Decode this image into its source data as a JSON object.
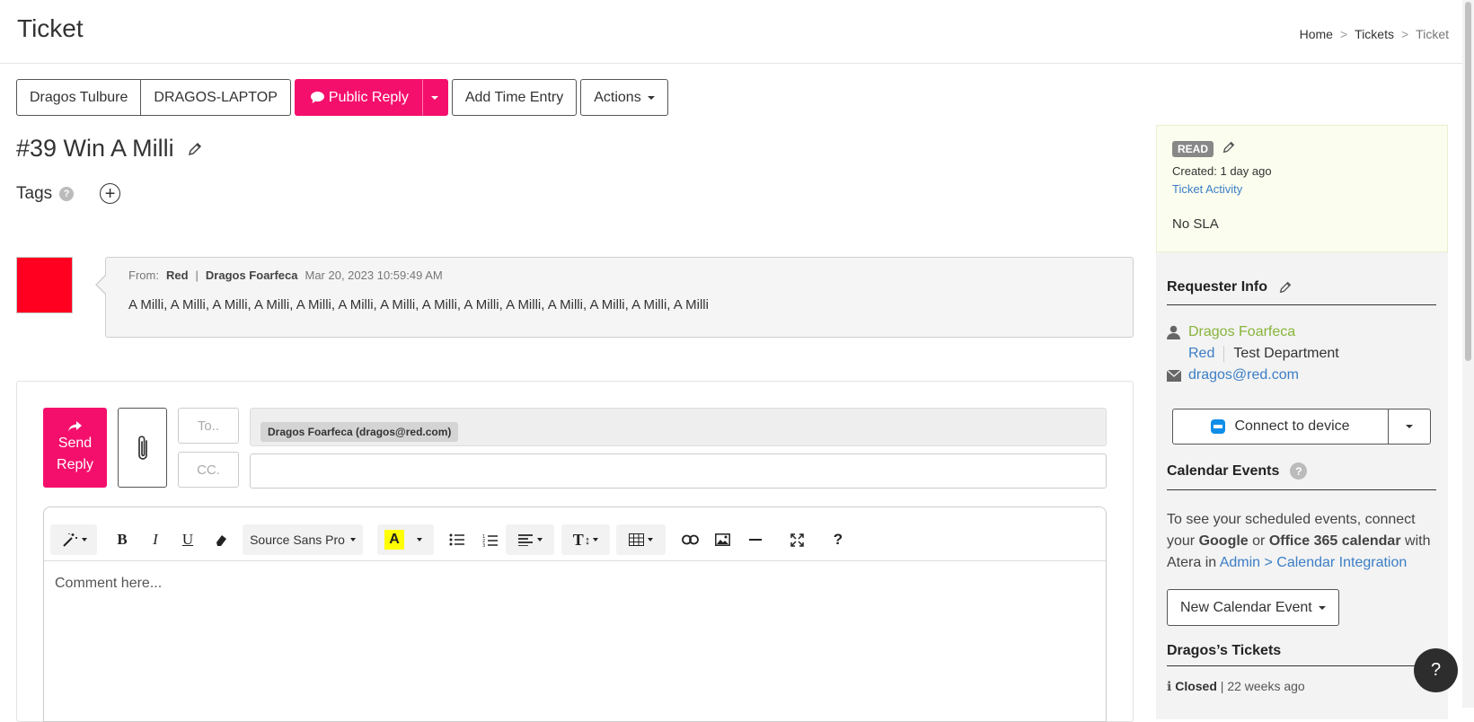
{
  "header": {
    "title": "Ticket",
    "breadcrumb": [
      "Home",
      "Tickets",
      "Ticket"
    ],
    "breadcrumb_sep": ">"
  },
  "toolbar": {
    "customer": "Dragos Tulbure",
    "device": "DRAGOS-LAPTOP",
    "public_reply": "Public Reply",
    "add_time_entry": "Add Time Entry",
    "actions": "Actions"
  },
  "ticket": {
    "title": "#39 Win A Milli",
    "tags_label": "Tags"
  },
  "message": {
    "from_label": "From:",
    "from_customer": "Red",
    "sep": "|",
    "from_name": "Dragos Foarfeca",
    "date": "Mar 20, 2023 10:59:49 AM",
    "body": "A Milli, A Milli, A Milli, A Milli, A Milli, A Milli, A Milli, A Milli, A Milli, A Milli, A Milli, A Milli, A Milli, A Milli"
  },
  "reply": {
    "send_line1": "Send",
    "send_line2": "Reply",
    "to_label": "To..",
    "cc_label": "CC.",
    "recipient": "Dragos Foarfeca (dragos@red.com)",
    "font_name": "Source Sans Pro",
    "placeholder": "Comment here...",
    "help_glyph": "?"
  },
  "sidebar": {
    "status_badge": "READ",
    "created": "Created: 1 day ago",
    "activity_link": "Ticket Activity",
    "sla": "No SLA",
    "requester_heading": "Requester Info",
    "requester_name": "Dragos Foarfeca",
    "requester_customer": "Red",
    "requester_department": "Test Department",
    "requester_email": "dragos@red.com",
    "connect_label": "Connect to device",
    "calendar_heading": "Calendar Events",
    "calendar_text_1": "To see your scheduled events, connect your ",
    "calendar_google": "Google",
    "calendar_or": " or ",
    "calendar_office": "Office 365 calendar",
    "calendar_text_2": " with Atera in ",
    "calendar_link": "Admin > Calendar Integration",
    "new_event_label": "New Calendar Event",
    "tickets_heading": "Dragos’s Tickets",
    "closed_status": "Closed",
    "closed_time": "| 22 weeks ago"
  },
  "fab": {
    "label": "?"
  },
  "colors": {
    "accent_pink": "#f50f6c",
    "link_blue": "#3b7ec6",
    "requester_green": "#87b43a",
    "avatar_red": "#ff0021"
  }
}
